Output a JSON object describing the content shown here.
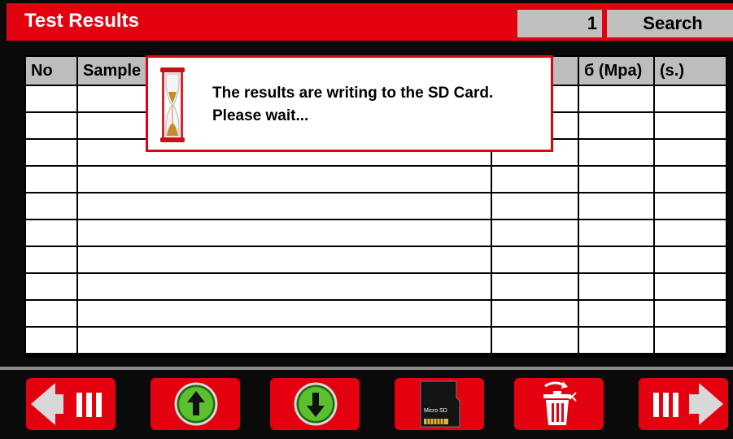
{
  "header": {
    "title": "Test Results",
    "search_value": "1",
    "search_label": "Search"
  },
  "table": {
    "columns": [
      "No",
      "Sample",
      "",
      "б (Mpa)",
      "(s.)"
    ],
    "row_count": 10
  },
  "dialog": {
    "line1": "The results are writing to the SD Card.",
    "line2": "Please wait..."
  },
  "footer": {
    "sd_card_label": "Micro SD",
    "buttons": [
      "previous-page",
      "scroll-up",
      "scroll-down",
      "export-sd-card",
      "delete",
      "next-page"
    ]
  },
  "colors": {
    "accent": "#e3000f",
    "header_gray": "#bdbdbd",
    "arrow_green": "#3aa421"
  },
  "icons": [
    "hourglass-icon",
    "arrow-left-icon",
    "arrow-up-icon",
    "arrow-down-icon",
    "sd-card-icon",
    "trash-icon",
    "arrow-right-icon"
  ]
}
